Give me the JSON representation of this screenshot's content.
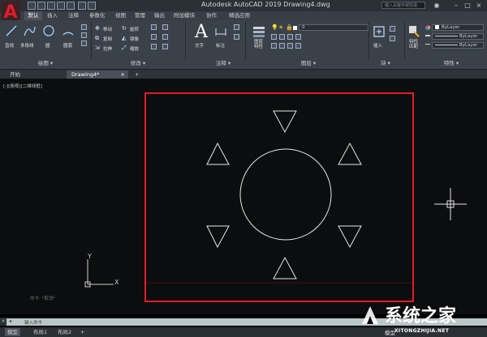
{
  "titlebar": {
    "app_logo": "A",
    "title": "Autodesk AutoCAD 2019    Drawing4.dwg",
    "search_placeholder": "键入关键字或短语"
  },
  "ribbon_tabs": [
    "默认",
    "插入",
    "注释",
    "参数化",
    "视图",
    "管理",
    "输出",
    "附加模块",
    "协作",
    "精选应用"
  ],
  "ribbon": {
    "draw": {
      "title": "绘图 ▾",
      "tools": [
        "直线",
        "多段线",
        "圆",
        "圆弧"
      ]
    },
    "modify": {
      "title": "修改 ▾",
      "rows": [
        [
          "移动",
          "旋转"
        ],
        [
          "复制",
          "镜像"
        ],
        [
          "拉伸",
          "缩放"
        ]
      ]
    },
    "annotation": {
      "title": "注释 ▾",
      "tools": [
        "文字",
        "标注"
      ]
    },
    "layers": {
      "title": "图层 ▾",
      "properties_label": "图层\n特性",
      "layer_value": "0"
    },
    "block": {
      "title": "块 ▾",
      "insert_label": "插入"
    },
    "properties": {
      "title": "特性 ▾",
      "match_label": "特性\n匹配",
      "bylayer_1": "ByLayer",
      "bylayer_2": "ByLayer",
      "bylayer_3": "ByLayer"
    }
  },
  "doc_tabs": {
    "start": "开始",
    "drawing": "Drawing4*",
    "close": "×",
    "add": "+"
  },
  "viewport": {
    "label": "[-][俯视][二维线框]",
    "ucs_y": "Y",
    "ucs_x": "X",
    "history": [
      "命令: *取消*",
      "",
      ""
    ]
  },
  "command": {
    "placeholder": "键入命令"
  },
  "status": {
    "layouts": [
      "模型",
      "布局1",
      "布局2"
    ],
    "add": "+",
    "model_label": "模型"
  },
  "watermark": {
    "logo_text": "系统之家",
    "url": "XITONGZHIJIA.NET"
  },
  "colors": {
    "red_frame": "#e21b2a",
    "background": "#0c0d0e",
    "ribbon": "#3b4149",
    "command_bar": "#b9c7c6"
  }
}
